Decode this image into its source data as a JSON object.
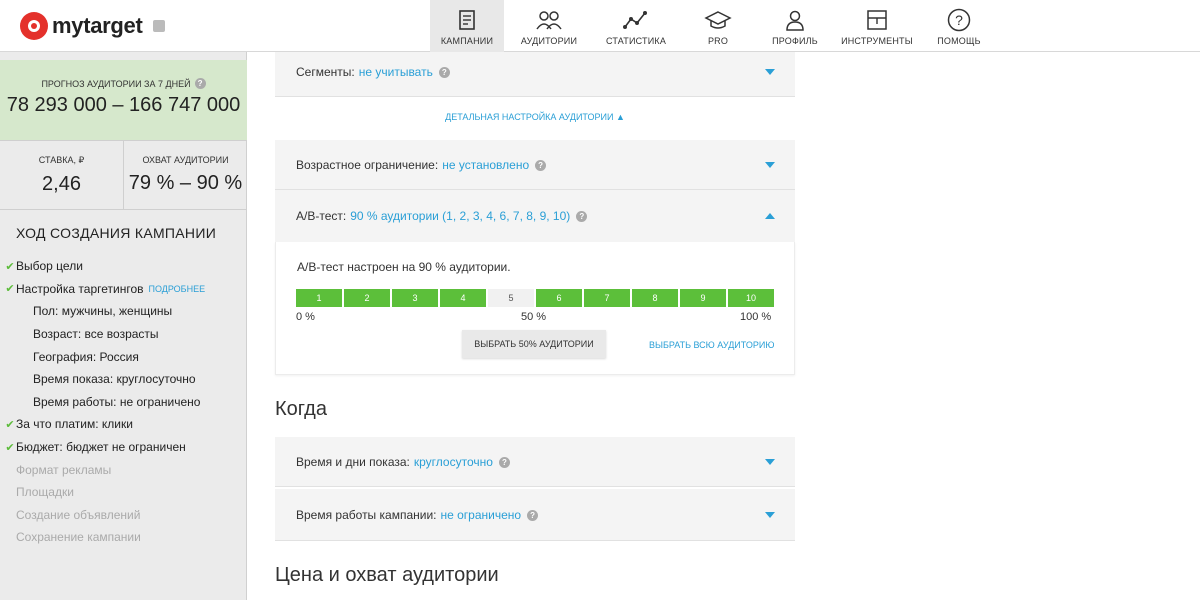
{
  "app": {
    "logo_text": "mytarget"
  },
  "nav": [
    {
      "label": "КАМПАНИИ",
      "icon": "campaigns-icon",
      "active": true
    },
    {
      "label": "АУДИТОРИИ",
      "icon": "audiences-icon",
      "active": false
    },
    {
      "label": "СТАТИСТИКА",
      "icon": "statistics-icon",
      "active": false
    },
    {
      "label": "PRO",
      "icon": "pro-icon",
      "active": false
    },
    {
      "label": "ПРОФИЛЬ",
      "icon": "profile-icon",
      "active": false
    },
    {
      "label": "ИНСТРУМЕНТЫ",
      "icon": "tools-icon",
      "active": false
    },
    {
      "label": "ПОМОЩЬ",
      "icon": "help-icon",
      "active": false
    }
  ],
  "sidebar": {
    "forecast_label": "ПРОГНОЗ АУДИТОРИИ ЗА 7 ДНЕЙ",
    "forecast_value": "78 293 000 – 166 747 000",
    "rate_label": "СТАВКА, ₽",
    "rate_value": "2,46",
    "reach_label": "ОХВАТ АУДИТОРИИ",
    "reach_value": "79 % – 90 %",
    "progress_title": "ХОД СОЗДАНИЯ КАМПАНИИ",
    "steps": [
      {
        "label": "Выбор цели",
        "state": "done"
      },
      {
        "label": "Настройка таргетингов",
        "state": "done",
        "more": "ПОДРОБНЕЕ"
      },
      {
        "label": "Пол: мужчины, женщины",
        "state": "sub"
      },
      {
        "label": "Возраст: все возрасты",
        "state": "sub"
      },
      {
        "label": "География: Россия",
        "state": "sub"
      },
      {
        "label": "Время показа: круглосуточно",
        "state": "sub"
      },
      {
        "label": "Время работы: не ограничено",
        "state": "sub"
      },
      {
        "label": "За что платим: клики",
        "state": "done"
      },
      {
        "label": "Бюджет: бюджет не ограничен",
        "state": "done"
      },
      {
        "label": "Формат рекламы",
        "state": "todo"
      },
      {
        "label": "Площадки",
        "state": "todo"
      },
      {
        "label": "Создание объявлений",
        "state": "todo"
      },
      {
        "label": "Сохранение кампании",
        "state": "todo"
      }
    ]
  },
  "main": {
    "segments_row": {
      "label": "Сегменты:",
      "value": "не учитывать"
    },
    "detail_link": "ДЕТАЛЬНАЯ НАСТРОЙКА АУДИТОРИИ",
    "age_row": {
      "label": "Возрастное ограничение:",
      "value": "не установлено"
    },
    "ab_row": {
      "label": "A/B-тест:",
      "value": "90 % аудитории (1, 2, 3, 4, 6, 7, 8, 9, 10)"
    },
    "ab_text": "A/B-тест настроен на 90 % аудитории.",
    "ab_segments": [
      {
        "label": "1",
        "on": true
      },
      {
        "label": "2",
        "on": true
      },
      {
        "label": "3",
        "on": true
      },
      {
        "label": "4",
        "on": true
      },
      {
        "label": "5",
        "on": false
      },
      {
        "label": "6",
        "on": true
      },
      {
        "label": "7",
        "on": true
      },
      {
        "label": "8",
        "on": true
      },
      {
        "label": "9",
        "on": true
      },
      {
        "label": "10",
        "on": true
      }
    ],
    "scale": [
      "0 %",
      "50 %",
      "100 %"
    ],
    "btn_half": "ВЫБРАТЬ 50% АУДИТОРИИ",
    "btn_all": "ВЫБРАТЬ ВСЮ АУДИТОРИЮ",
    "when_title": "Когда",
    "time_row": {
      "label": "Время и дни показа:",
      "value": "круглосуточно"
    },
    "work_row": {
      "label": "Время работы кампании:",
      "value": "не ограничено"
    },
    "price_title": "Цена и охват аудитории"
  },
  "colors": {
    "accent": "#2a9fd6",
    "green": "#5cbf3a",
    "forecast_bg": "#d6e8cc",
    "brand": "#e4312b"
  }
}
